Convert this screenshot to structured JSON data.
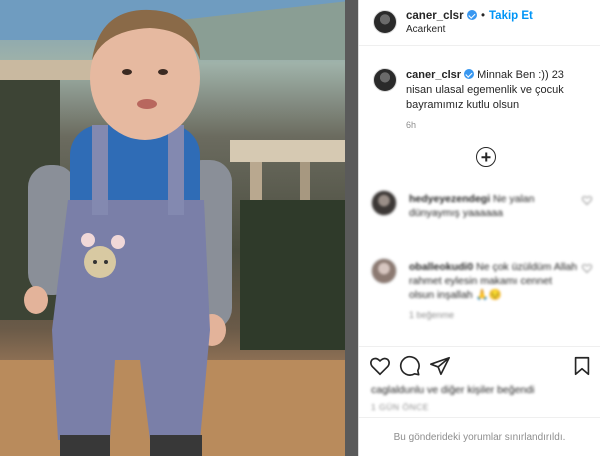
{
  "post": {
    "username": "caner_clsr",
    "follow_label": "Takip Et",
    "dot": "•",
    "location": "Acarkent",
    "caption": "Minnak Ben :)) 23 nisan ulasal egemenlik ve çocuk bayramımız kutlu olsun",
    "time": "6h"
  },
  "comments": [
    {
      "username": "hedyeyezendegi",
      "text": "Ne yalan dünyaymış yaaaaaa",
      "meta": ""
    },
    {
      "username": "oballeokudi0",
      "text": "Ne çok üzüldüm Allah rahmet eylesin makamı cennet olsun inşallah 🙏😔",
      "meta": "1 beğenme"
    }
  ],
  "footer": {
    "likes": "caglaldunlu ve diğer kişiler beğendi",
    "date": "1 GÜN ÖNCE",
    "restricted": "Bu gönderideki yorumlar sınırlandırıldı."
  },
  "colors": {
    "accent": "#0095f6",
    "verified": "#3897f0",
    "muted": "#8e8e8e"
  },
  "icons": [
    "verified-icon",
    "add-comment-icon",
    "heart-icon",
    "comment-icon",
    "share-icon",
    "bookmark-icon"
  ]
}
